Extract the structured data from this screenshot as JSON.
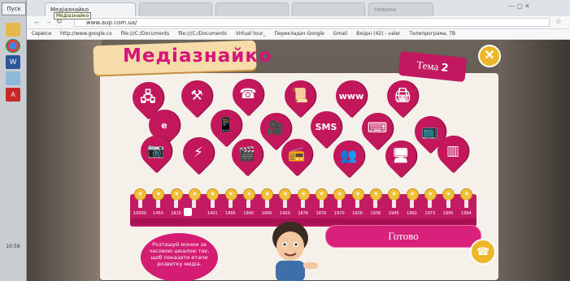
{
  "taskbar": {
    "start_label": "Пуск",
    "clock": "10:58"
  },
  "browser": {
    "tabs": [
      "Медіазнайко",
      "",
      "",
      "",
      "Новини"
    ],
    "tooltip": "Медіазнайко",
    "url": "www.aup.com.ua/",
    "bookmarks": [
      "Сервіси",
      "http://www.google.co",
      "file:///C:/Documents",
      "file:///C:/Documents",
      "Virtual tour_",
      "Перекладач Google",
      "Gmail",
      "Вхідні (42) - valer",
      "Телепрограма, ТВ"
    ]
  },
  "app": {
    "title": "Медіазнайко",
    "tema_label": "Тема",
    "tema_number": "2",
    "close_glyph": "✕",
    "done_button": "Готово",
    "hint_text": "Розташуй іконки за часовою шкалою так, щоб показати етапи розвитку медіа."
  },
  "media_icons": [
    {
      "name": "network-icon",
      "glyph": "🖧"
    },
    {
      "name": "anvil-icon",
      "glyph": "⚒"
    },
    {
      "name": "telephone-icon",
      "glyph": "☎"
    },
    {
      "name": "scroll-icon",
      "glyph": "📜"
    },
    {
      "name": "www-icon",
      "glyph": "www"
    },
    {
      "name": "printing-press-icon",
      "glyph": "🖨"
    },
    {
      "name": "internet-explorer-icon",
      "glyph": "e"
    },
    {
      "name": "remote-control-icon",
      "glyph": "📱"
    },
    {
      "name": "film-projector-icon",
      "glyph": "🎥"
    },
    {
      "name": "sms-icon",
      "glyph": "SMS"
    },
    {
      "name": "keyboard-icon",
      "glyph": "⌨"
    },
    {
      "name": "television-icon",
      "glyph": "📺"
    },
    {
      "name": "camera-icon",
      "glyph": "📷"
    },
    {
      "name": "telegraph-icon",
      "glyph": "⚡"
    },
    {
      "name": "clapperboard-icon",
      "glyph": "🎬"
    },
    {
      "name": "radio-icon",
      "glyph": "📻"
    },
    {
      "name": "people-icon",
      "glyph": "👥"
    },
    {
      "name": "computer-icon",
      "glyph": "🖥"
    },
    {
      "name": "papyrus-icon",
      "glyph": "▥"
    }
  ],
  "timeline": {
    "years": [
      "10000",
      "1450",
      "1815",
      "1",
      "1401",
      "1895",
      "1840",
      "1900",
      "1900",
      "1876",
      "1876",
      "1970",
      "1926",
      "1936",
      "1945",
      "1962",
      "1973",
      "1995",
      "1994"
    ]
  },
  "colors": {
    "accent_pink": "#c2185b",
    "accent_gold": "#f0b62a"
  }
}
